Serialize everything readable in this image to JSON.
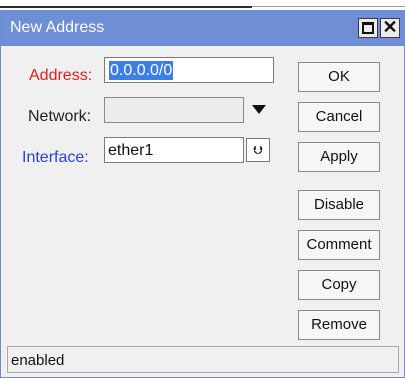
{
  "window": {
    "title": "New Address",
    "titlebar_color": "#6e8ed6",
    "controls": {
      "maximize": "maximize-icon",
      "close": "close-icon",
      "close_glyph": "✕"
    }
  },
  "form": {
    "address": {
      "label": "Address:",
      "value": "0.0.0.0/0",
      "label_color": "#e02020"
    },
    "network": {
      "label": "Network:",
      "value": "",
      "label_color": "#222222"
    },
    "interface": {
      "label": "Interface:",
      "value": "ether1",
      "label_color": "#2540e0",
      "dropdown_glyph": "⮋"
    }
  },
  "buttons": {
    "ok": "OK",
    "cancel": "Cancel",
    "apply": "Apply",
    "disable": "Disable",
    "comment": "Comment",
    "copy": "Copy",
    "remove": "Remove"
  },
  "status": {
    "text": "enabled"
  }
}
